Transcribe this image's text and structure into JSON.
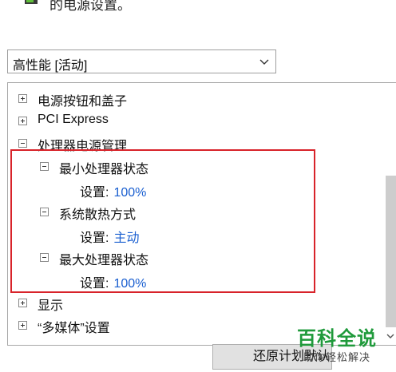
{
  "header": {
    "text": "的电源设置。"
  },
  "plan_select": {
    "value": "高性能 [活动]"
  },
  "tree": {
    "power_buttons": "电源按钮和盖子",
    "pci_express": "PCI Express",
    "processor_power": "处理器电源管理",
    "min_state": {
      "label": "最小处理器状态",
      "setting_key": "设置:",
      "setting_value": "100%"
    },
    "cooling": {
      "label": "系统散热方式",
      "setting_key": "设置:",
      "setting_value": "主动"
    },
    "max_state": {
      "label": "最大处理器状态",
      "setting_key": "设置:",
      "setting_value": "100%"
    },
    "display": "显示",
    "multimedia": "“多媒体”设置"
  },
  "buttons": {
    "restore": "还原计划默认值"
  },
  "watermark": {
    "main": "百科全说",
    "sub": "助你轻松解决"
  },
  "colors": {
    "setting_value": "#1a5fd0",
    "highlight": "#d8232a",
    "watermark": "#1f9a3b"
  }
}
